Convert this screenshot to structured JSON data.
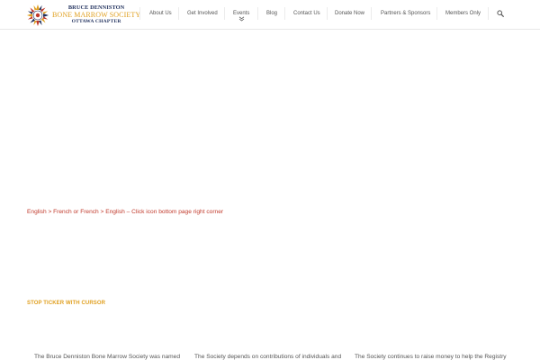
{
  "logo": {
    "line1": "BRUCE DENNISTON",
    "line2": "BONE MARROW SOCIETY",
    "line3": "OTTAWA CHAPTER",
    "colors": {
      "navy": "#1f2f5c",
      "gold": "#e0a021",
      "red": "#c0392b"
    }
  },
  "nav": {
    "items": [
      {
        "label": "About Us"
      },
      {
        "label": "Get Involved"
      },
      {
        "label": "Events",
        "has_submenu": true
      },
      {
        "label": "Blog"
      },
      {
        "label": "Contact Us"
      },
      {
        "label": "Donate Now"
      },
      {
        "label": "Partners & Sponsors"
      },
      {
        "label": "Members Only"
      }
    ],
    "search_icon": "search-icon"
  },
  "content": {
    "language_note": "English > French or French > English – Click icon bottom page right corner",
    "ticker_stop": "STOP TICKER WITH CURSOR",
    "ticker_items": [
      "The Bruce Denniston Bone Marrow Society was named",
      "The Society depends on contributions of individuals and",
      "The Society continues to raise money to help the Registry"
    ]
  },
  "colors": {
    "nav_text": "#555555",
    "accent_gold": "#e0a021",
    "link_red": "#c0392b",
    "background": "#ffffff"
  }
}
